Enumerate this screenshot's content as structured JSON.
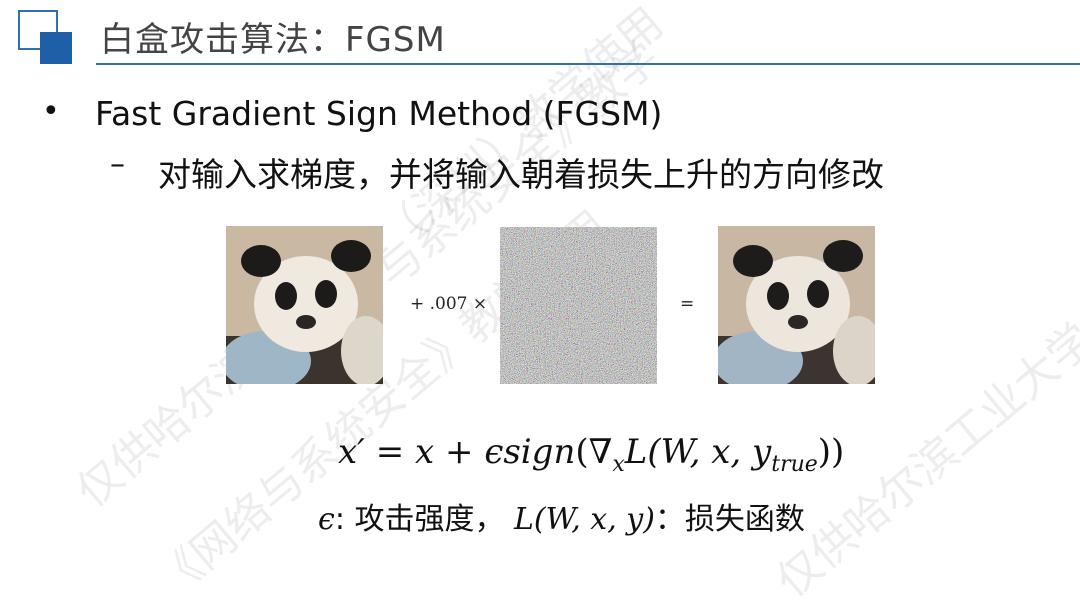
{
  "slide": {
    "title": "白盒攻击算法：FGSM",
    "bullet": {
      "symbol": "•",
      "text": "Fast Gradient Sign Method (FGSM)"
    },
    "sub_bullet": {
      "symbol": "–",
      "text": "对输入求梯度，并将输入朝着损失上升的方向修改"
    },
    "figure": {
      "operator_coefficient": "+ .007 ×",
      "operator_equals": "="
    },
    "formula": {
      "lhs": "x′",
      "equals": " = ",
      "x": "x",
      "plus": " + ",
      "epsilon_sign": "ϵsign",
      "open": "(∇",
      "grad_sub": "x",
      "loss": "L",
      "args": "(W, x, y",
      "target_sub": "true",
      "close": "))"
    },
    "legend": {
      "epsilon_symbol": "ϵ",
      "epsilon_text": ": 攻击强度，  ",
      "loss_symbol": "L(W, x, y)",
      "loss_text": "：损失函数"
    },
    "watermarks": [
      "仅供哈尔滨工业大学（深圳）教学使用",
      "《网络与系统安全》教学使用",
      "仅供哈尔滨工业大学（深圳）",
      "与系统安全》教学"
    ]
  },
  "colors": {
    "accent_blue": "#1f5fa8",
    "rule_blue": "#2f6fb3",
    "title_gray": "#444444"
  }
}
